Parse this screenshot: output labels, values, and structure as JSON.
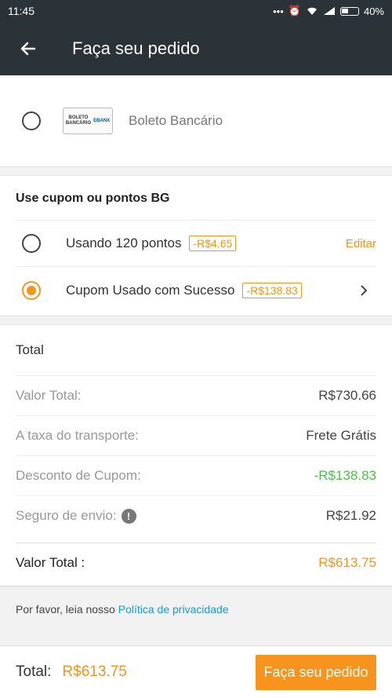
{
  "status_bar": {
    "time": "11:45",
    "battery": "40%"
  },
  "header": {
    "title": "Faça seu pedido"
  },
  "payment": {
    "label": "Boleto Bancário",
    "logo_text_1": "BOLETO",
    "logo_text_2": "BANCÁRIO",
    "logo_brand": "EBANX"
  },
  "coupon": {
    "title": "Use cupom ou pontos BG",
    "points_label": "Usando 120 pontos",
    "points_discount": "-R$4.65",
    "edit_label": "Editar",
    "coupon_label": "Cupom Usado com Sucesso",
    "coupon_discount": "-R$138.83"
  },
  "totals": {
    "title": "Total",
    "rows": [
      {
        "label": "Valor Total:",
        "value": "R$730.66"
      },
      {
        "label": "A taxa do transporte:",
        "value": "Frete Grátis"
      },
      {
        "label": "Desconto de Cupom:",
        "value": "-R$138.83"
      },
      {
        "label": "Seguro de envio:",
        "value": "R$21.92"
      }
    ],
    "final_label": "Valor Total :",
    "final_value": "R$613.75"
  },
  "privacy": {
    "text": "Por favor, leia nosso",
    "link": "Política de privacidade"
  },
  "bottom": {
    "total_label": "Total:",
    "total_value": "R$613.75",
    "order_button": "Faça seu pedido"
  },
  "colors": {
    "accent": "#f7941d",
    "header_bg": "#2c3338",
    "link": "#1a9ad6",
    "discount": "#4cc24a"
  }
}
